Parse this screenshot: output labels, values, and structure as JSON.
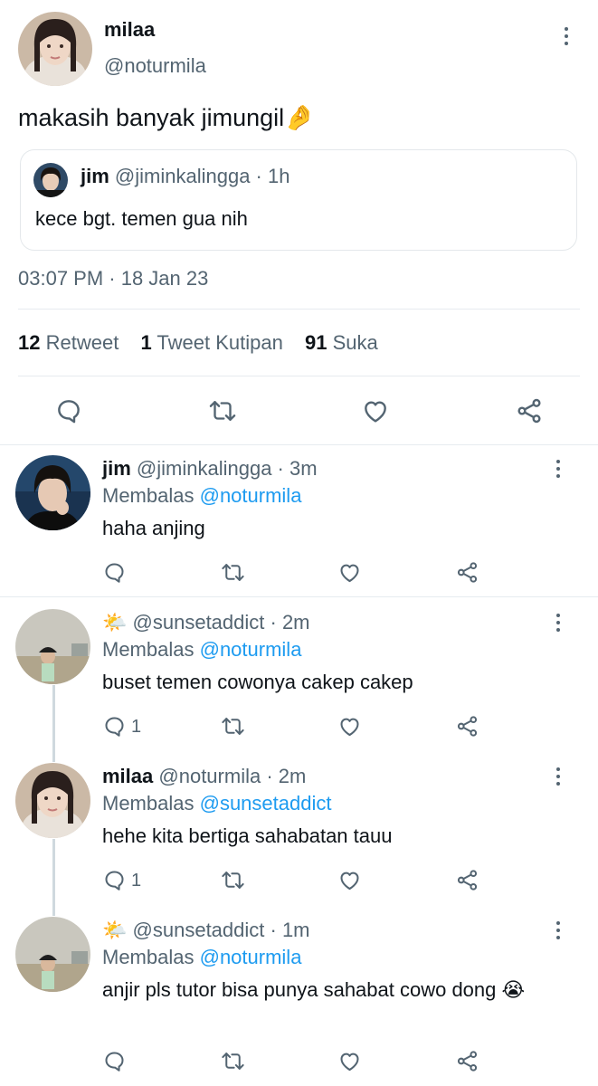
{
  "main_tweet": {
    "name": "milaa",
    "handle": "@noturmila",
    "text": "makasih banyak jimungil🤌",
    "quote": {
      "name": "jim",
      "handle": "@jiminkalingga · 1h",
      "text": "kece bgt. temen gua nih"
    },
    "timestamp": "03:07 PM · 18 Jan 23",
    "stats": {
      "retweets": "12",
      "retweets_label": "Retweet",
      "quotes": "1",
      "quotes_label": "Tweet Kutipan",
      "likes": "91",
      "likes_label": "Suka"
    },
    "actions": [
      "reply-icon",
      "retweet-icon",
      "like-icon",
      "share-icon"
    ]
  },
  "replies": [
    {
      "name": "jim",
      "handle": "@jiminkalingga · 3m",
      "replying_label": "Membalas",
      "replying_to": "@noturmila",
      "text": "haha anjing",
      "reply_count": ""
    },
    {
      "emoji": "🌤️",
      "name": "",
      "handle": "@sunsetaddict · 2m",
      "replying_label": "Membalas",
      "replying_to": "@noturmila",
      "text": "buset temen cowonya cakep cakep",
      "reply_count": "1"
    },
    {
      "name": "milaa",
      "handle": "@noturmila · 2m",
      "replying_label": "Membalas",
      "replying_to": "@sunsetaddict",
      "text": "hehe kita bertiga sahabatan tauu",
      "reply_count": "1"
    },
    {
      "emoji": "🌤️",
      "name": "",
      "handle": "@sunsetaddict · 1m",
      "replying_label": "Membalas",
      "replying_to": "@noturmila",
      "text": "anjir pls tutor bisa punya sahabat cowo dong 😭",
      "reply_count": ""
    }
  ],
  "colors": {
    "text": "#0f1419",
    "muted": "#536471",
    "link": "#1d9bf0",
    "divider": "#e6ebef"
  }
}
